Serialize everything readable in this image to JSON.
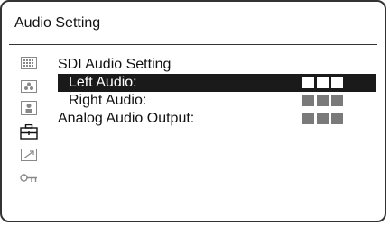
{
  "window": {
    "title": "Audio Setting"
  },
  "sidebar": {
    "icons": [
      {
        "name": "grid-icon"
      },
      {
        "name": "dots-icon"
      },
      {
        "name": "person-icon"
      },
      {
        "name": "toolbox-icon",
        "active": true
      },
      {
        "name": "arrow-icon"
      },
      {
        "name": "key-icon"
      }
    ]
  },
  "menu": {
    "section": "SDI Audio Setting",
    "items": [
      {
        "label": "Left Audio:",
        "value_squares": 3,
        "selected": true
      },
      {
        "label": "Right Audio:",
        "value_squares": 3,
        "selected": false
      },
      {
        "label": "Analog Audio Output:",
        "value_squares": 3,
        "selected": false
      }
    ]
  },
  "colors": {
    "selected_bg": "#1a1a1a",
    "selected_fg": "#ffffff",
    "value_square": "#7a7a7a",
    "border": "#333333"
  }
}
